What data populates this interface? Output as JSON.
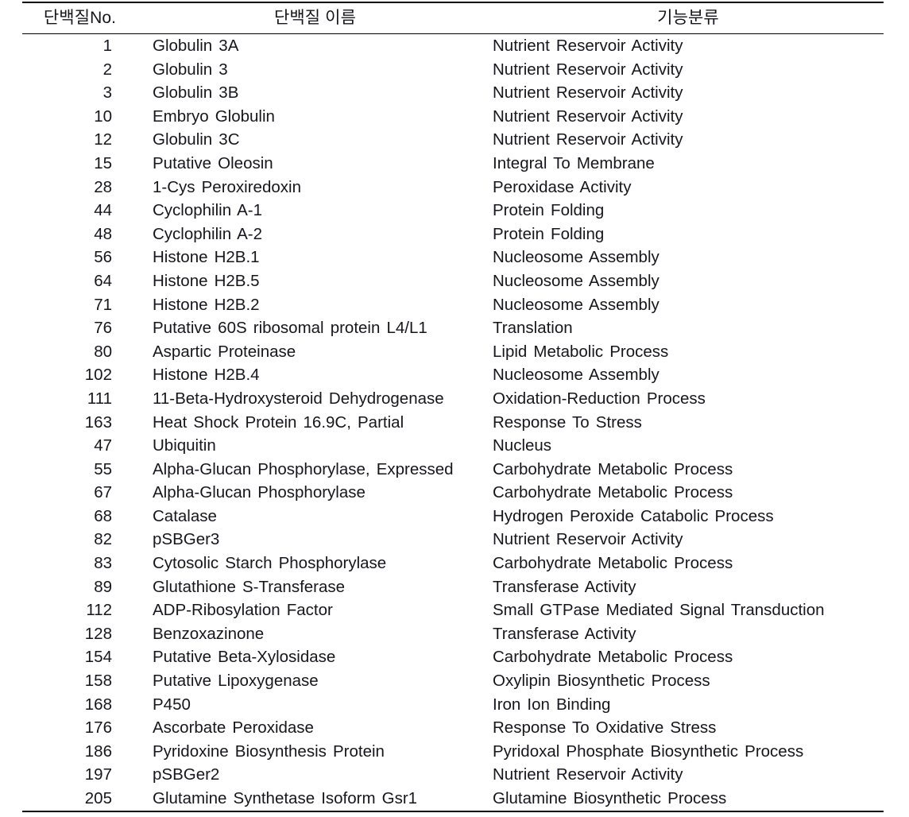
{
  "table": {
    "columns": [
      {
        "key": "no",
        "label": "단백질No."
      },
      {
        "key": "name",
        "label": "단백질 이름"
      },
      {
        "key": "func",
        "label": "기능분류"
      }
    ],
    "rows": [
      {
        "no": "1",
        "name": "Globulin 3A",
        "func": "Nutrient Reservoir Activity"
      },
      {
        "no": "2",
        "name": "Globulin 3",
        "func": "Nutrient Reservoir Activity"
      },
      {
        "no": "3",
        "name": "Globulin 3B",
        "func": "Nutrient Reservoir Activity"
      },
      {
        "no": "10",
        "name": "Embryo Globulin",
        "func": "Nutrient Reservoir Activity"
      },
      {
        "no": "12",
        "name": "Globulin 3C",
        "func": "Nutrient Reservoir Activity"
      },
      {
        "no": "15",
        "name": "Putative Oleosin",
        "func": "Integral To Membrane"
      },
      {
        "no": "28",
        "name": "1-Cys Peroxiredoxin",
        "func": "Peroxidase Activity"
      },
      {
        "no": "44",
        "name": "Cyclophilin A-1",
        "func": "Protein Folding"
      },
      {
        "no": "48",
        "name": "Cyclophilin A-2",
        "func": "Protein Folding"
      },
      {
        "no": "56",
        "name": "Histone H2B.1",
        "func": "Nucleosome Assembly"
      },
      {
        "no": "64",
        "name": "Histone H2B.5",
        "func": "Nucleosome Assembly"
      },
      {
        "no": "71",
        "name": "Histone H2B.2",
        "func": "Nucleosome Assembly"
      },
      {
        "no": "76",
        "name": "Putative 60S ribosomal protein L4/L1",
        "func": "Translation"
      },
      {
        "no": "80",
        "name": "Aspartic Proteinase",
        "func": "Lipid Metabolic Process"
      },
      {
        "no": "102",
        "name": "Histone H2B.4",
        "func": "Nucleosome Assembly"
      },
      {
        "no": "111",
        "name": "11-Beta-Hydroxysteroid Dehydrogenase",
        "func": "Oxidation-Reduction Process"
      },
      {
        "no": "163",
        "name": "Heat Shock Protein 16.9C, Partial",
        "func": "Response To Stress"
      },
      {
        "no": "47",
        "name": "Ubiquitin",
        "func": "Nucleus"
      },
      {
        "no": "55",
        "name": "Alpha-Glucan Phosphorylase, Expressed",
        "func": "Carbohydrate Metabolic Process"
      },
      {
        "no": "67",
        "name": "Alpha-Glucan Phosphorylase",
        "func": "Carbohydrate Metabolic Process"
      },
      {
        "no": "68",
        "name": "Catalase",
        "func": "Hydrogen Peroxide Catabolic Process"
      },
      {
        "no": "82",
        "name": "pSBGer3",
        "func": "Nutrient Reservoir Activity"
      },
      {
        "no": "83",
        "name": "Cytosolic Starch Phosphorylase",
        "func": "Carbohydrate Metabolic Process"
      },
      {
        "no": "89",
        "name": "Glutathione S-Transferase",
        "func": "Transferase Activity"
      },
      {
        "no": "112",
        "name": "ADP-Ribosylation Factor",
        "func": "Small GTPase Mediated Signal Transduction"
      },
      {
        "no": "128",
        "name": "Benzoxazinone",
        "func": "Transferase Activity"
      },
      {
        "no": "154",
        "name": "Putative Beta-Xylosidase",
        "func": "Carbohydrate Metabolic Process"
      },
      {
        "no": "158",
        "name": "Putative Lipoxygenase",
        "func": "Oxylipin Biosynthetic Process"
      },
      {
        "no": "168",
        "name": "P450",
        "func": "Iron Ion Binding"
      },
      {
        "no": "176",
        "name": "Ascorbate Peroxidase",
        "func": "Response To Oxidative Stress"
      },
      {
        "no": "186",
        "name": "Pyridoxine Biosynthesis Protein",
        "func": "Pyridoxal Phosphate Biosynthetic Process"
      },
      {
        "no": "197",
        "name": "pSBGer2",
        "func": "Nutrient Reservoir Activity"
      },
      {
        "no": "205",
        "name": "Glutamine Synthetase Isoform Gsr1",
        "func": "Glutamine Biosynthetic Process"
      }
    ]
  },
  "colors": {
    "text": "#16161d",
    "rule": "#000000",
    "background": "#ffffff"
  }
}
